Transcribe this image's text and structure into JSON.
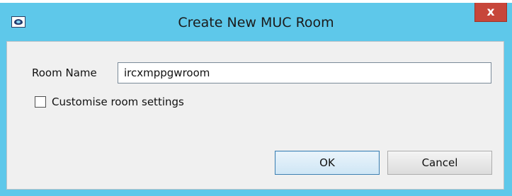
{
  "window": {
    "title": "Create New MUC Room",
    "close_glyph": "x",
    "app_icon": "spark-chat-icon",
    "title_bar_color": "#5ec8ea",
    "close_button_color": "#c7463a"
  },
  "form": {
    "room_name_label": "Room Name",
    "room_name_value": "ircxmppgwroom",
    "customise_checkbox_label": "Customise room settings",
    "customise_checked": false
  },
  "buttons": {
    "ok_label": "OK",
    "cancel_label": "Cancel"
  }
}
